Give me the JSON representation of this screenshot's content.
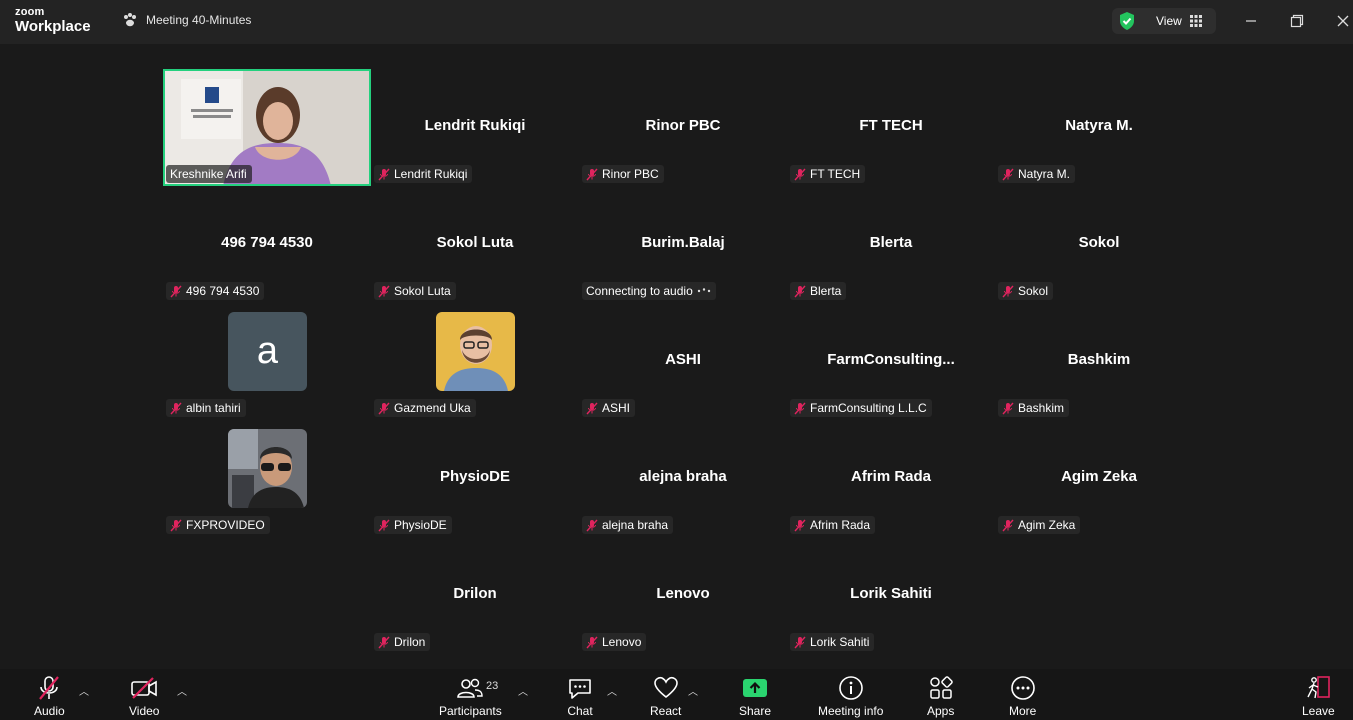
{
  "app": {
    "logo_top": "zoom",
    "logo_bottom": "Workplace",
    "meeting_title": "Meeting 40-Minutes",
    "view_label": "View"
  },
  "participants": [
    {
      "tile_name": "",
      "label": "Kreshnike Arifi"
    },
    {
      "tile_name": "Lendrit Rukiqi",
      "label": "Lendrit Rukiqi"
    },
    {
      "tile_name": "Rinor PBC",
      "label": "Rinor PBC"
    },
    {
      "tile_name": "FT TECH",
      "label": "FT TECH"
    },
    {
      "tile_name": "Natyra M.",
      "label": "Natyra M."
    },
    {
      "tile_name": "496 794 4530",
      "label": "496 794 4530"
    },
    {
      "tile_name": "Sokol Luta",
      "label": "Sokol Luta"
    },
    {
      "tile_name": "Burim.Balaj",
      "label": "Connecting to audio"
    },
    {
      "tile_name": "Blerta",
      "label": "Blerta"
    },
    {
      "tile_name": "Sokol",
      "label": "Sokol"
    },
    {
      "tile_name": "",
      "label": "albin tahiri",
      "avatar_letter": "a"
    },
    {
      "tile_name": "",
      "label": "Gazmend Uka"
    },
    {
      "tile_name": "ASHI",
      "label": "ASHI"
    },
    {
      "tile_name": "FarmConsulting...",
      "label": "FarmConsulting L.L.C"
    },
    {
      "tile_name": "Bashkim",
      "label": "Bashkim"
    },
    {
      "tile_name": "",
      "label": "FXPROVIDEO"
    },
    {
      "tile_name": "PhysioDE",
      "label": "PhysioDE"
    },
    {
      "tile_name": "alejna braha",
      "label": "alejna braha"
    },
    {
      "tile_name": "Afrim Rada",
      "label": "Afrim Rada"
    },
    {
      "tile_name": "Agim Zeka",
      "label": "Agim Zeka"
    },
    {
      "tile_name": "Drilon",
      "label": "Drilon"
    },
    {
      "tile_name": "Lenovo",
      "label": "Lenovo"
    },
    {
      "tile_name": "Lorik Sahiti",
      "label": "Lorik Sahiti"
    }
  ],
  "toolbar": {
    "audio": "Audio",
    "video": "Video",
    "participants": "Participants",
    "participants_count": "23",
    "chat": "Chat",
    "react": "React",
    "share": "Share",
    "meeting_info": "Meeting info",
    "apps": "Apps",
    "more": "More",
    "leave": "Leave"
  },
  "colors": {
    "active_speaker": "#24d07e",
    "muted": "#e0245e",
    "share": "#2ad46f"
  }
}
